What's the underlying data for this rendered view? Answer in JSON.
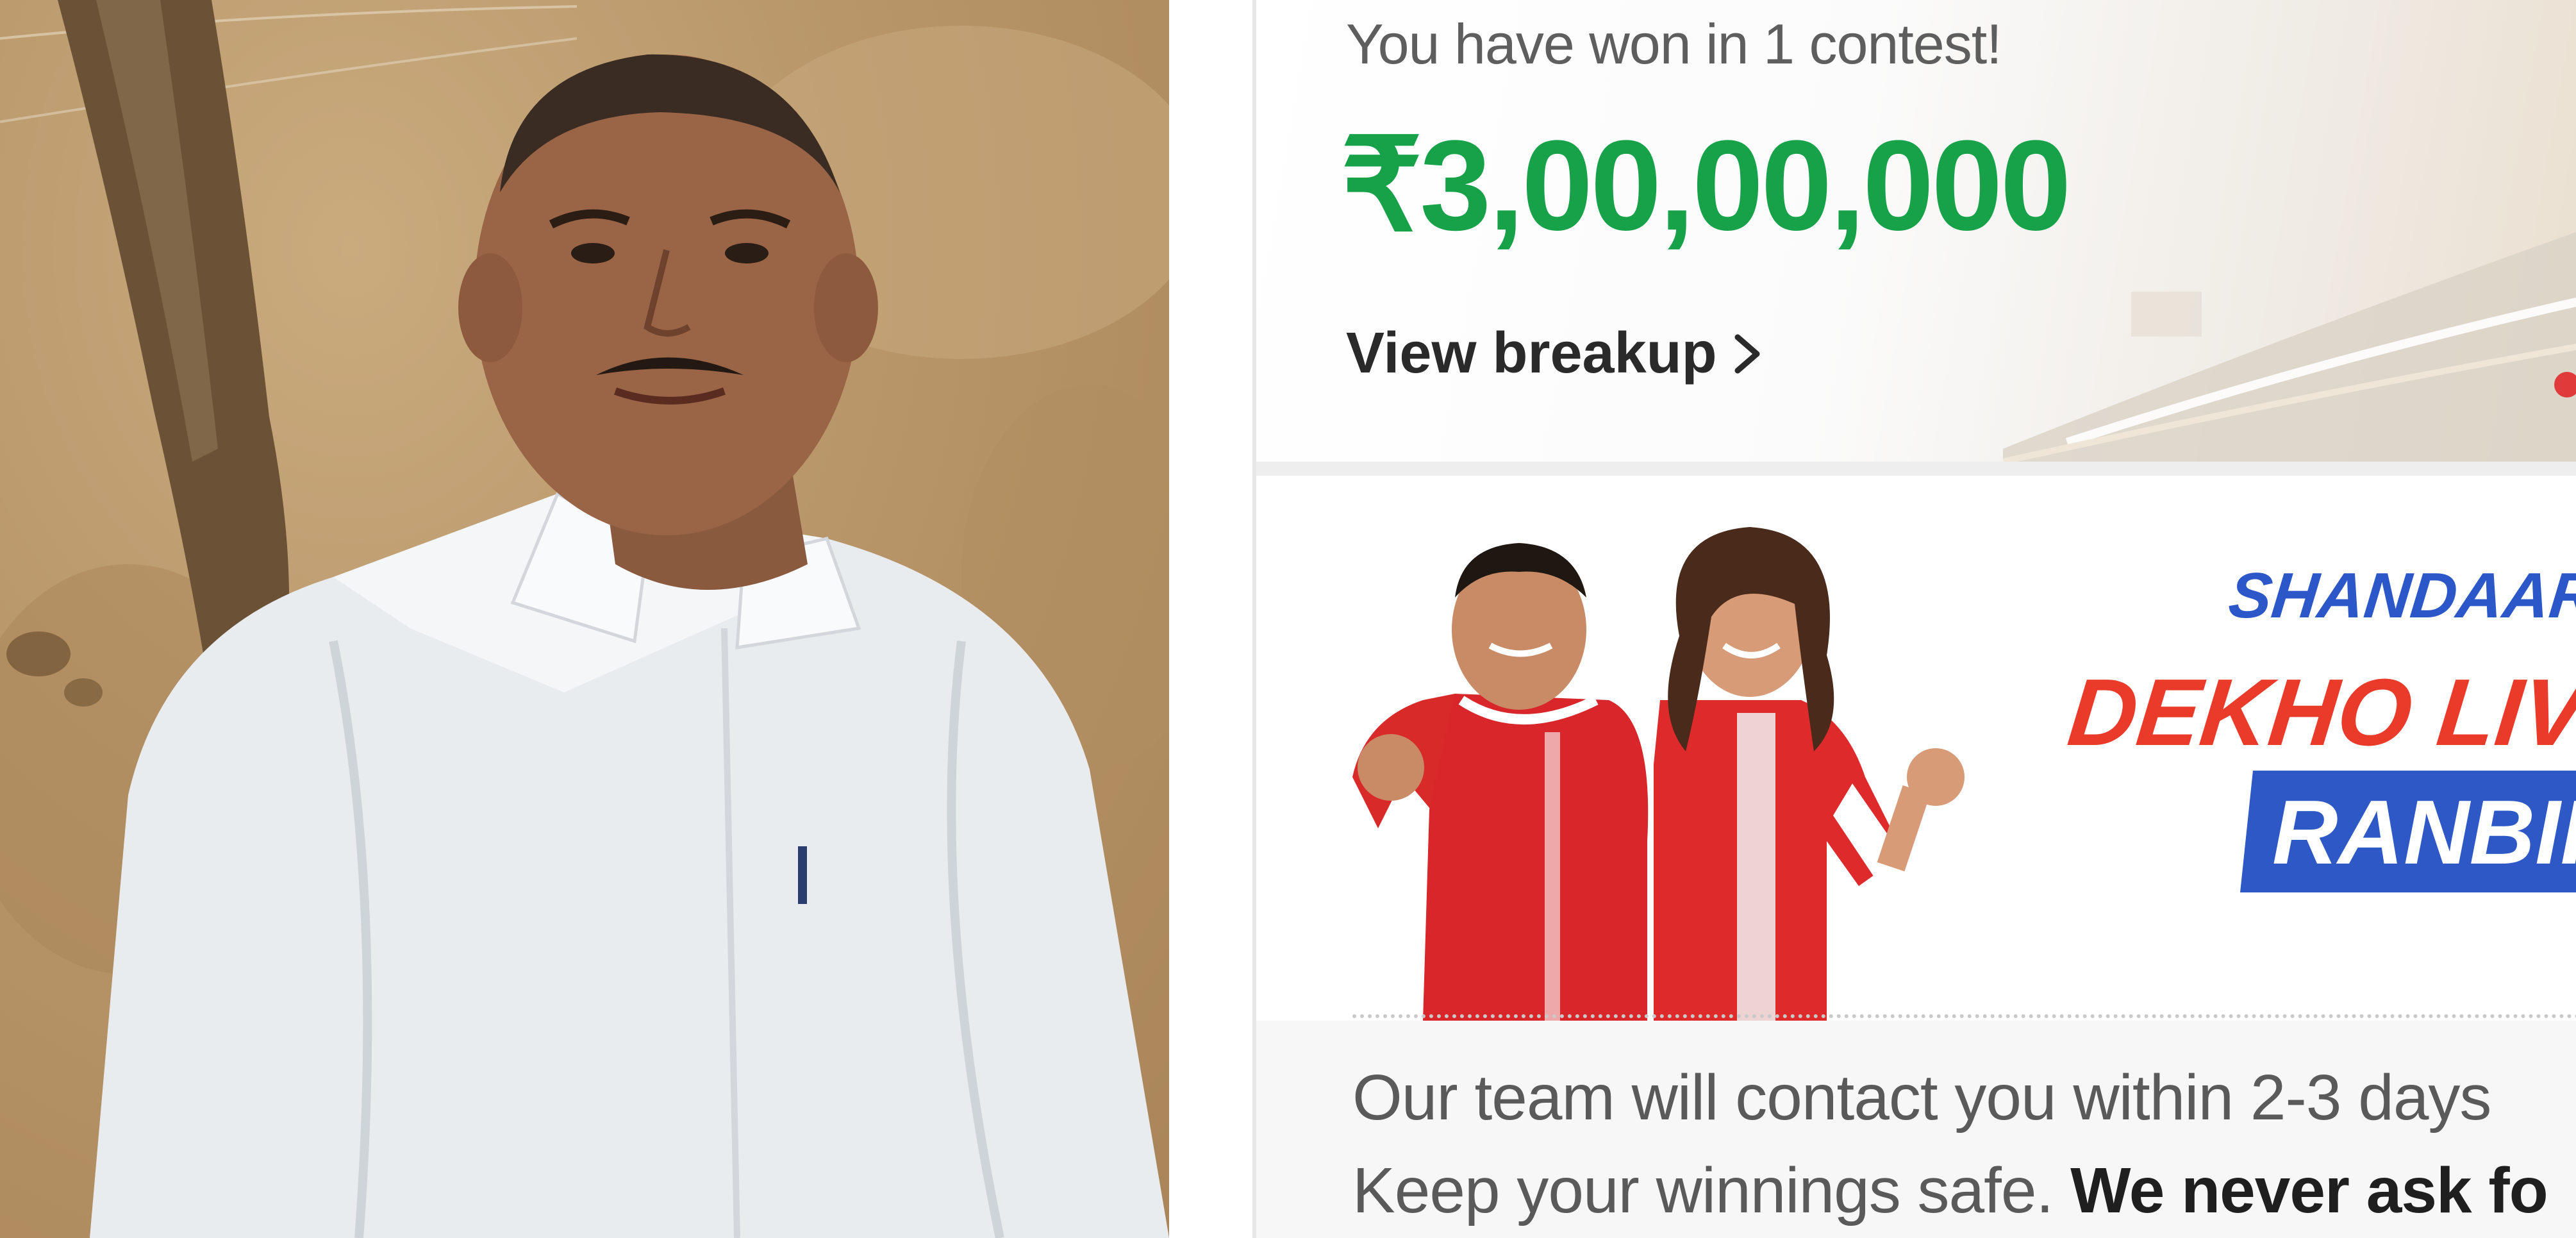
{
  "win_card": {
    "won_message": "You have won in 1 contest!",
    "prize_amount": "₹3,00,00,000",
    "view_breakup_label": "View breakup",
    "chevron_icon": "chevron-right-icon",
    "prize_color": "#17a24a"
  },
  "promo_banner": {
    "headline_1": "SHANDAAR",
    "headline_2": "DEKHO LIVE M",
    "badge_text": "RANBIR",
    "headline_1_color": "#2b57c8",
    "headline_2_color": "#ea3a2a"
  },
  "footer": {
    "contact_line": "Our team will contact you within 2-3 days",
    "safe_line_start": "Keep your winnings safe. ",
    "safe_line_bold": "We never ask fo"
  }
}
